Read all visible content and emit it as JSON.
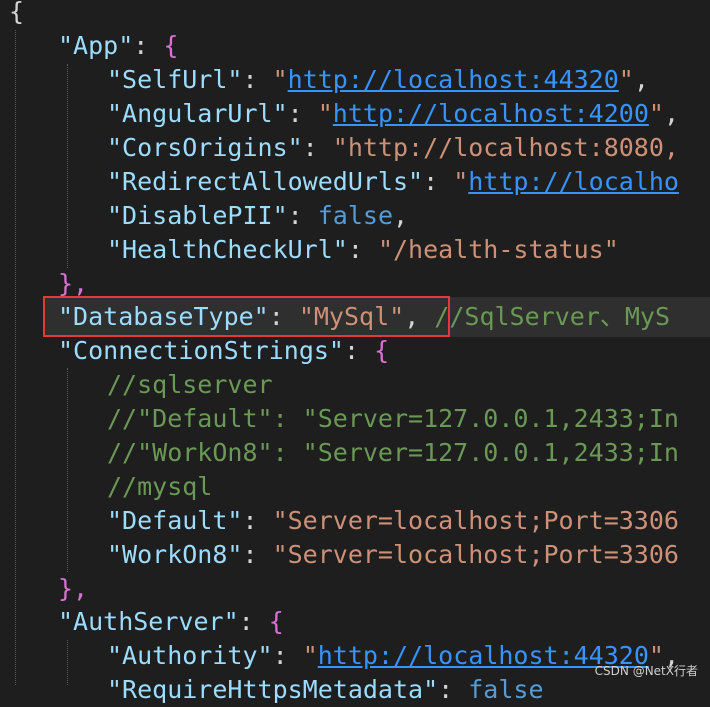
{
  "lines": {
    "l1": {
      "open": "{"
    },
    "l2": {
      "key": "\"App\"",
      "colon": ": ",
      "open": "{"
    },
    "l3": {
      "key": "\"SelfUrl\"",
      "colon": ": ",
      "q1": "\"",
      "url": "http://localhost:44320",
      "q2": "\"",
      "tail": ","
    },
    "l4": {
      "key": "\"AngularUrl\"",
      "colon": ": ",
      "q1": "\"",
      "url": "http://localhost:4200",
      "q2": "\"",
      "tail": ","
    },
    "l5": {
      "key": "\"CorsOrigins\"",
      "colon": ": ",
      "value": "\"http://localhost:8080,"
    },
    "l6": {
      "key": "\"RedirectAllowedUrls\"",
      "colon": ": ",
      "q1": "\"",
      "url": "http://localho"
    },
    "l7": {
      "key": "\"DisablePII\"",
      "colon": ": ",
      "value": "false",
      "tail": ","
    },
    "l8": {
      "key": "\"HealthCheckUrl\"",
      "colon": ": ",
      "value": "\"/health-status\""
    },
    "l9": {
      "close": "},"
    },
    "l10": {
      "key": "\"DatabaseType\"",
      "colon": ": ",
      "value": "\"MySql\"",
      "tail": ",",
      "comment": " //SqlServer、MyS"
    },
    "l11": {
      "key": "\"ConnectionStrings\"",
      "colon": ": ",
      "open": "{"
    },
    "l12": {
      "comment": "//sqlserver"
    },
    "l13": {
      "comment": "//\"Default\": \"Server=127.0.0.1,2433;In"
    },
    "l14": {
      "comment": "//\"WorkOn8\": \"Server=127.0.0.1,2433;In"
    },
    "l15": {
      "comment": "//mysql"
    },
    "l16": {
      "key": "\"Default\"",
      "colon": ": ",
      "value": "\"Server=localhost;Port=3306"
    },
    "l17": {
      "key": "\"WorkOn8\"",
      "colon": ": ",
      "value": "\"Server=localhost;Port=3306"
    },
    "l18": {
      "close": "},"
    },
    "l19": {
      "key": "\"AuthServer\"",
      "colon": ": ",
      "open": "{"
    },
    "l20": {
      "key": "\"Authority\"",
      "colon": ": ",
      "q1": "\"",
      "url": "http://localhost:44320",
      "q2": "\"",
      "tail": ","
    },
    "l21": {
      "key": "\"RequireHttpsMetadata\"",
      "colon": ": ",
      "value": "false"
    }
  },
  "watermark": "CSDN @NetX行者",
  "colors": {
    "background": "#1e1e1e",
    "key": "#9cdcfe",
    "string": "#ce9178",
    "link": "#3794ff",
    "keyword": "#569cd6",
    "comment": "#6a9955",
    "highlight_border": "#e53935"
  }
}
